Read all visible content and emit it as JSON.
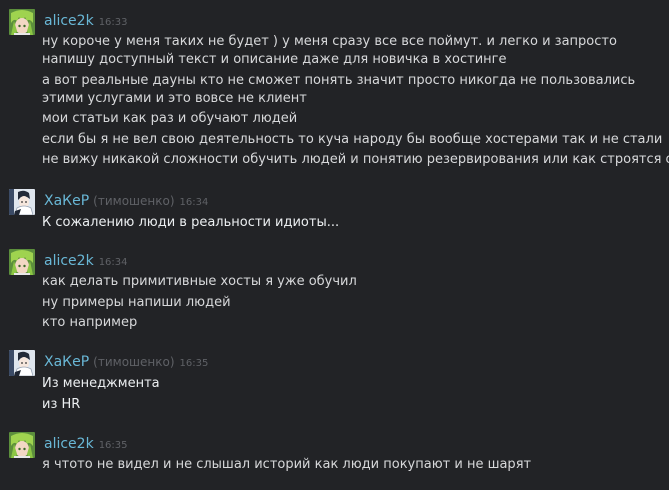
{
  "messages": [
    {
      "author": "alice2k",
      "nickname": "",
      "time": "16:33",
      "avatar": "green-hair-avatar-icon",
      "lines": [
        "ну короче у меня таких не будет ) у меня сразу все все поймут. и легко и запросто напишу доступный текст и описание даже для новичка в хостинге",
        "а вот реальные дауны кто не сможет понять значит просто никогда не пользовались этими услугами и это вовсе не клиент",
        "мои статьи как раз и обучают людей",
        "если бы я не вел свою деятельность то куча народу бы вообще хостерами так и не стали",
        "не вижу никакой сложности обучить людей и понятию резервирования или как строятся облака"
      ]
    },
    {
      "author": "ХаКеР",
      "nickname": "(тимошенко)",
      "time": "16:34",
      "avatar": "anime-character-avatar-icon",
      "lines": [
        "К сожалению люди в реальности идиоты..."
      ]
    },
    {
      "author": "alice2k",
      "nickname": "",
      "time": "16:34",
      "avatar": "green-hair-avatar-icon",
      "lines": [
        "как делать примитивные хосты я уже обучил",
        "ну примеры напиши людей",
        "кто например"
      ]
    },
    {
      "author": "ХаКеР",
      "nickname": "(тимошенко)",
      "time": "16:35",
      "avatar": "anime-character-avatar-icon",
      "lines": [
        "Из менеджмента",
        "из HR"
      ]
    },
    {
      "author": "alice2k",
      "nickname": "",
      "time": "16:35",
      "avatar": "green-hair-avatar-icon",
      "lines": [
        "я чтото не видел и не слышал историй как люди покупают и не шарят"
      ]
    }
  ],
  "colors": {
    "background": "#222326",
    "author": "#69b7d6",
    "meta": "#5f6166",
    "text": "#d7d8da"
  }
}
